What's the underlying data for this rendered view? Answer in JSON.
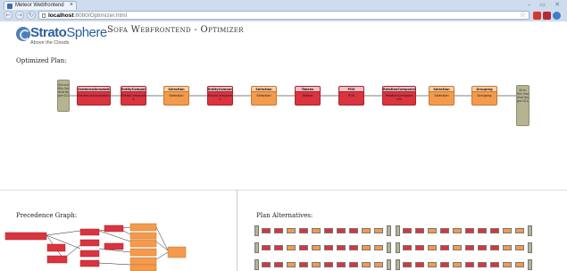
{
  "browser": {
    "tab_title": "Meteor Webfrontend",
    "url_host": "localhost",
    "url_port": ":8080",
    "url_path": "/Optimizer.html",
    "window_controls": "– ▭ ✕"
  },
  "logo": {
    "strato": "Strato",
    "sphere": "Sphere",
    "tagline": "Above the Clouds"
  },
  "page": {
    "title": "Sofa Webfrontend - Optimizer"
  },
  "sections": {
    "optimized_plan": "Optimized Plan:",
    "precedence_graph": "Precedence Graph:",
    "plan_alternatives": "Plan Alternatives:"
  },
  "plan_nodes": [
    {
      "kind": "src",
      "body": "Source: file:/home/fmschar/local/Plan/ distributedData gen3/1/prefixinput.json"
    },
    {
      "kind": "red",
      "head": "SentenceAnnotation(ByEnd)",
      "body": "SentenceAnnotation(ByEnd)"
    },
    {
      "kind": "red",
      "head": "EntityComponents",
      "body": "EntityComponent s"
    },
    {
      "kind": "org",
      "head": "Selection",
      "body": "Selection"
    },
    {
      "kind": "red",
      "head": "EntityComponents",
      "body": "EntityComponent s"
    },
    {
      "kind": "org",
      "head": "Selection",
      "body": "Selection"
    },
    {
      "kind": "red",
      "head": "Tokens",
      "body": "Tokens"
    },
    {
      "kind": "red",
      "head": "POS",
      "body": "POS"
    },
    {
      "kind": "red",
      "head": "RelationComponents",
      "body": "RelationCompone nts"
    },
    {
      "kind": "org",
      "head": "Selection",
      "body": "Selection"
    },
    {
      "kind": "org",
      "head": "Grouping",
      "body": "Grouping"
    },
    {
      "kind": "src",
      "body": "Sink: file:/home/fmschar/local/Plan/ distributedData gen3/1/output.json"
    }
  ],
  "colors": {
    "source": "#b5b492",
    "red_operator": "#d9343f",
    "orange_operator": "#f39a4d",
    "brand": "#2b5f9c"
  }
}
